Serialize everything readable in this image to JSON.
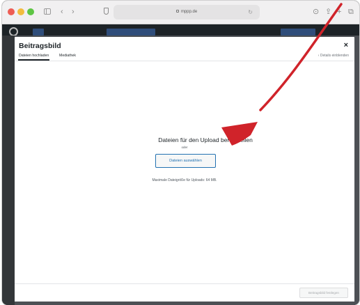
{
  "browser": {
    "url": "mppp.de",
    "back_icon": "chevron-left-icon",
    "forward_icon": "chevron-right-icon",
    "toolbar_right_icons": [
      "download-icon",
      "share-icon",
      "new-tab-icon",
      "tabs-overview-icon"
    ]
  },
  "modal": {
    "title": "Beitragsbild",
    "close_symbol": "×",
    "tabs": [
      {
        "label": "Dateien hochladen",
        "active": true
      },
      {
        "label": "Mediathek",
        "active": false
      }
    ],
    "details_toggle": "‹ Details einblenden",
    "upload": {
      "title": "Dateien für den Upload bereitstellen",
      "or_text": "oder",
      "select_button": "Dateien auswählen",
      "max_size": "Maximale Dateigröße für Uploads: 64 MB."
    },
    "footer_button": "Beitragsbild festlegen"
  },
  "annotation": {
    "arrow_color": "#d0232a"
  },
  "colors": {
    "wp_admin_bar": "#1d2327",
    "button_blue": "#2271b1"
  }
}
